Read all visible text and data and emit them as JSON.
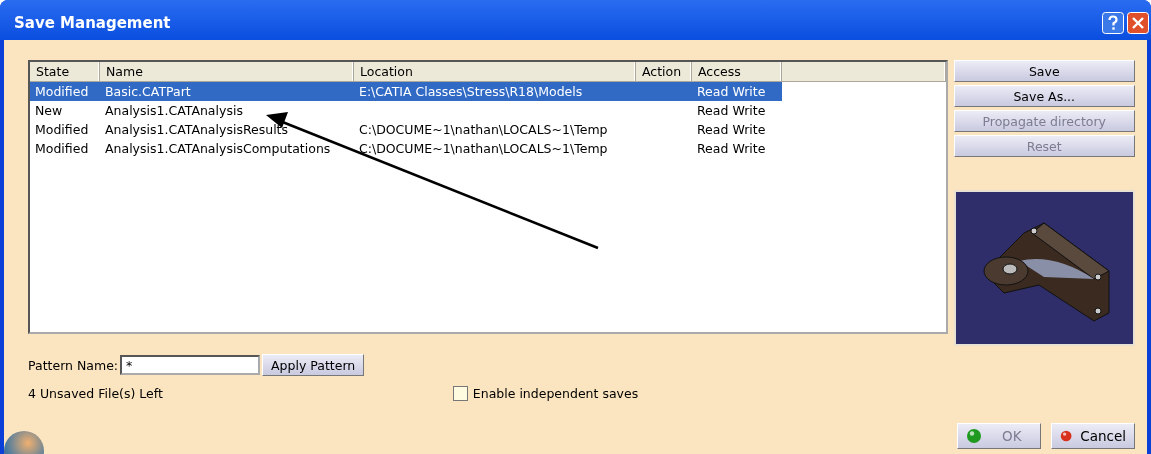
{
  "window": {
    "title": "Save Management"
  },
  "table": {
    "columns": [
      "State",
      "Name",
      "Location",
      "Action",
      "Access"
    ],
    "rows": [
      {
        "state": "Modified",
        "name": "Basic.CATPart",
        "location": "E:\\CATIA Classes\\Stress\\R18\\Models",
        "action": "",
        "access": "Read Write",
        "selected": true
      },
      {
        "state": "New",
        "name": "Analysis1.CATAnalysis",
        "location": "",
        "action": "",
        "access": "Read Write",
        "selected": false
      },
      {
        "state": "Modified",
        "name": "Analysis1.CATAnalysisResults",
        "location": "C:\\DOCUME~1\\nathan\\LOCALS~1\\Temp",
        "action": "",
        "access": "Read Write",
        "selected": false
      },
      {
        "state": "Modified",
        "name": "Analysis1.CATAnalysisComputations",
        "location": "C:\\DOCUME~1\\nathan\\LOCALS~1\\Temp",
        "action": "",
        "access": "Read Write",
        "selected": false
      }
    ]
  },
  "side_buttons": [
    {
      "label": "Save",
      "disabled": false
    },
    {
      "label": "Save As...",
      "disabled": false
    },
    {
      "label": "Propagate directory",
      "disabled": true
    },
    {
      "label": "Reset",
      "disabled": true
    }
  ],
  "pattern": {
    "label": "Pattern Name:",
    "value": "*",
    "button": "Apply Pattern"
  },
  "status": "4 Unsaved File(s) Left",
  "independent_saves": {
    "label": "Enable independent saves",
    "checked": false
  },
  "dialog_buttons": [
    {
      "label": "OK",
      "kind": "ok",
      "disabled": true
    },
    {
      "label": "Cancel",
      "kind": "cancel",
      "disabled": false
    }
  ]
}
